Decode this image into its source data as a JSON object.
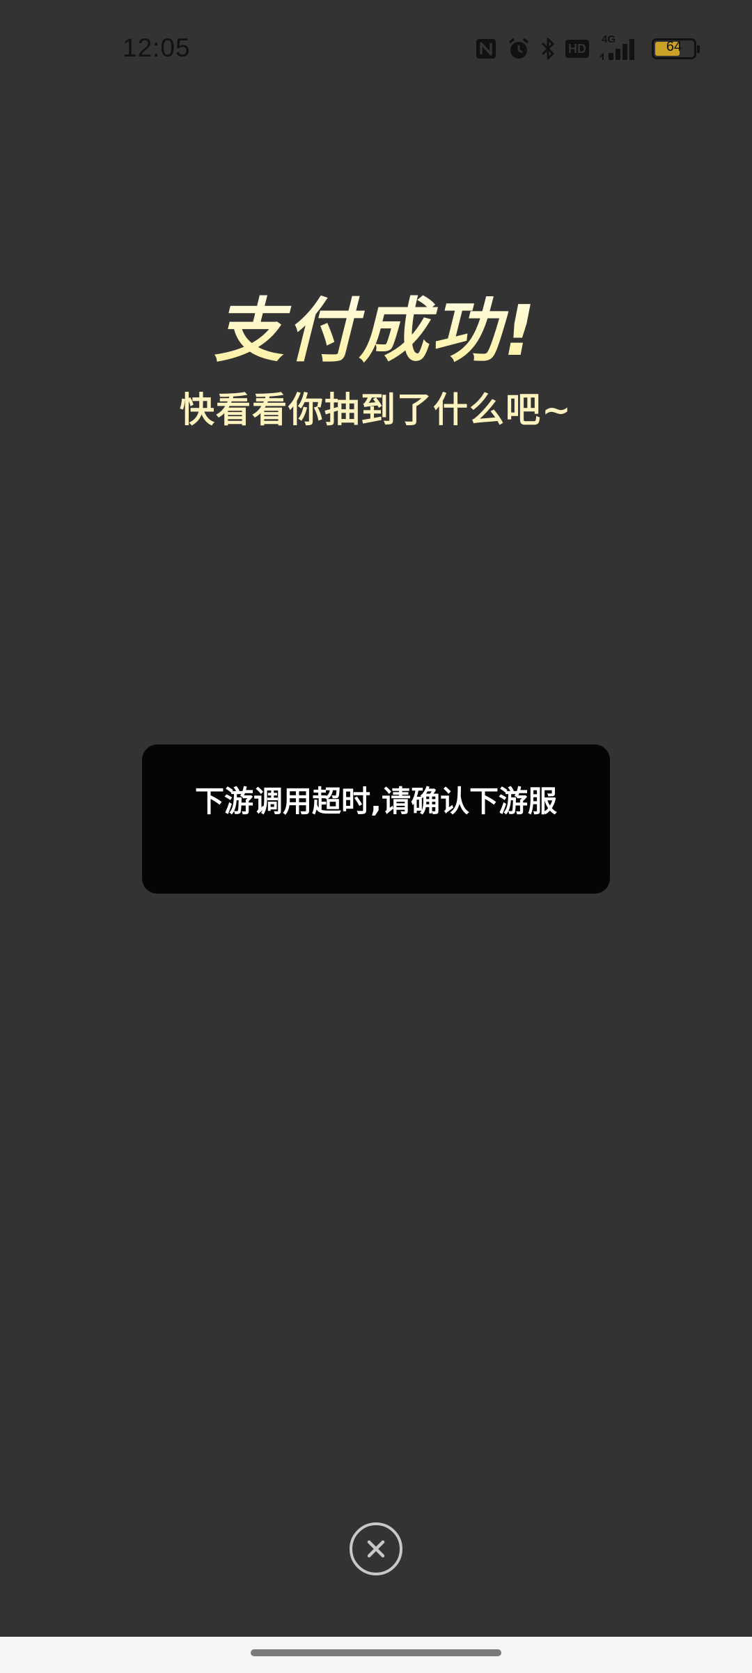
{
  "status_bar": {
    "time": "12:05",
    "battery_level": "64",
    "battery_fraction": 0.64,
    "icons": [
      "nfc-icon",
      "alarm-icon",
      "bluetooth-icon",
      "hd-icon",
      "signal-4g-icon",
      "battery-icon"
    ],
    "hd_label": "HD",
    "network_label": "4G"
  },
  "result": {
    "title": "支付成功!",
    "subtitle": "快看看你抽到了什么吧~"
  },
  "toast": {
    "message": "下游调用超时,请确认下游服"
  },
  "close": {
    "icon": "close-icon"
  },
  "colors": {
    "background": "#333333",
    "title_gold": "#fff1a0",
    "toast_bg": "#050505",
    "battery_fill": "#c9a227"
  }
}
